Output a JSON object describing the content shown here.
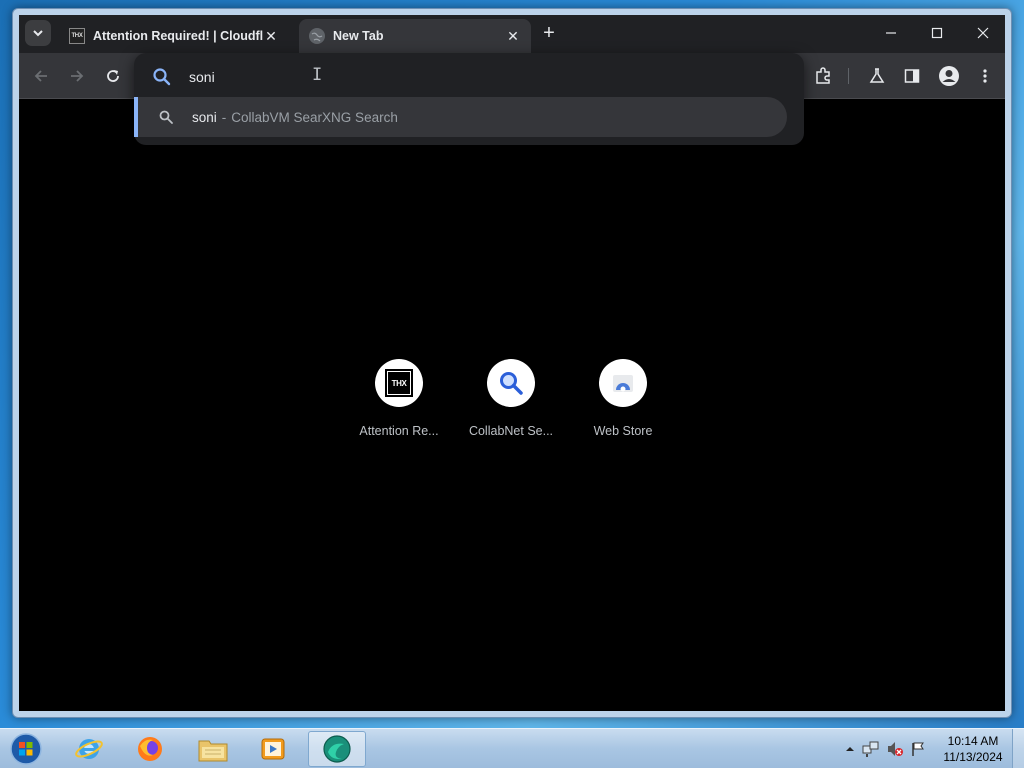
{
  "browser": {
    "tabs": [
      {
        "title": "Attention Required! | Cloudflare",
        "favicon": "thx-logo-icon",
        "active": false
      },
      {
        "title": "New Tab",
        "favicon": "globe-icon",
        "active": true
      }
    ],
    "omnibox": {
      "value": "soni",
      "suggestion": {
        "query": "soni",
        "separator": "-",
        "engine": "CollabVM SearXNG Search"
      }
    },
    "shortcuts": [
      {
        "label": "Attention Re...",
        "icon": "thx-logo-icon"
      },
      {
        "label": "CollabNet Se...",
        "icon": "magnifier-icon"
      },
      {
        "label": "Web Store",
        "icon": "web-store-icon"
      }
    ]
  },
  "taskbar": {
    "apps": [
      "start-orb",
      "internet-explorer",
      "firefox",
      "file-explorer",
      "media-player",
      "chrome-like-browser"
    ],
    "clock": {
      "time": "10:14 AM",
      "date": "11/13/2024"
    }
  },
  "colors": {
    "tabstrip": "#202124",
    "toolbar": "#35363a",
    "accent": "#8ab4f8",
    "page": "#000000"
  }
}
